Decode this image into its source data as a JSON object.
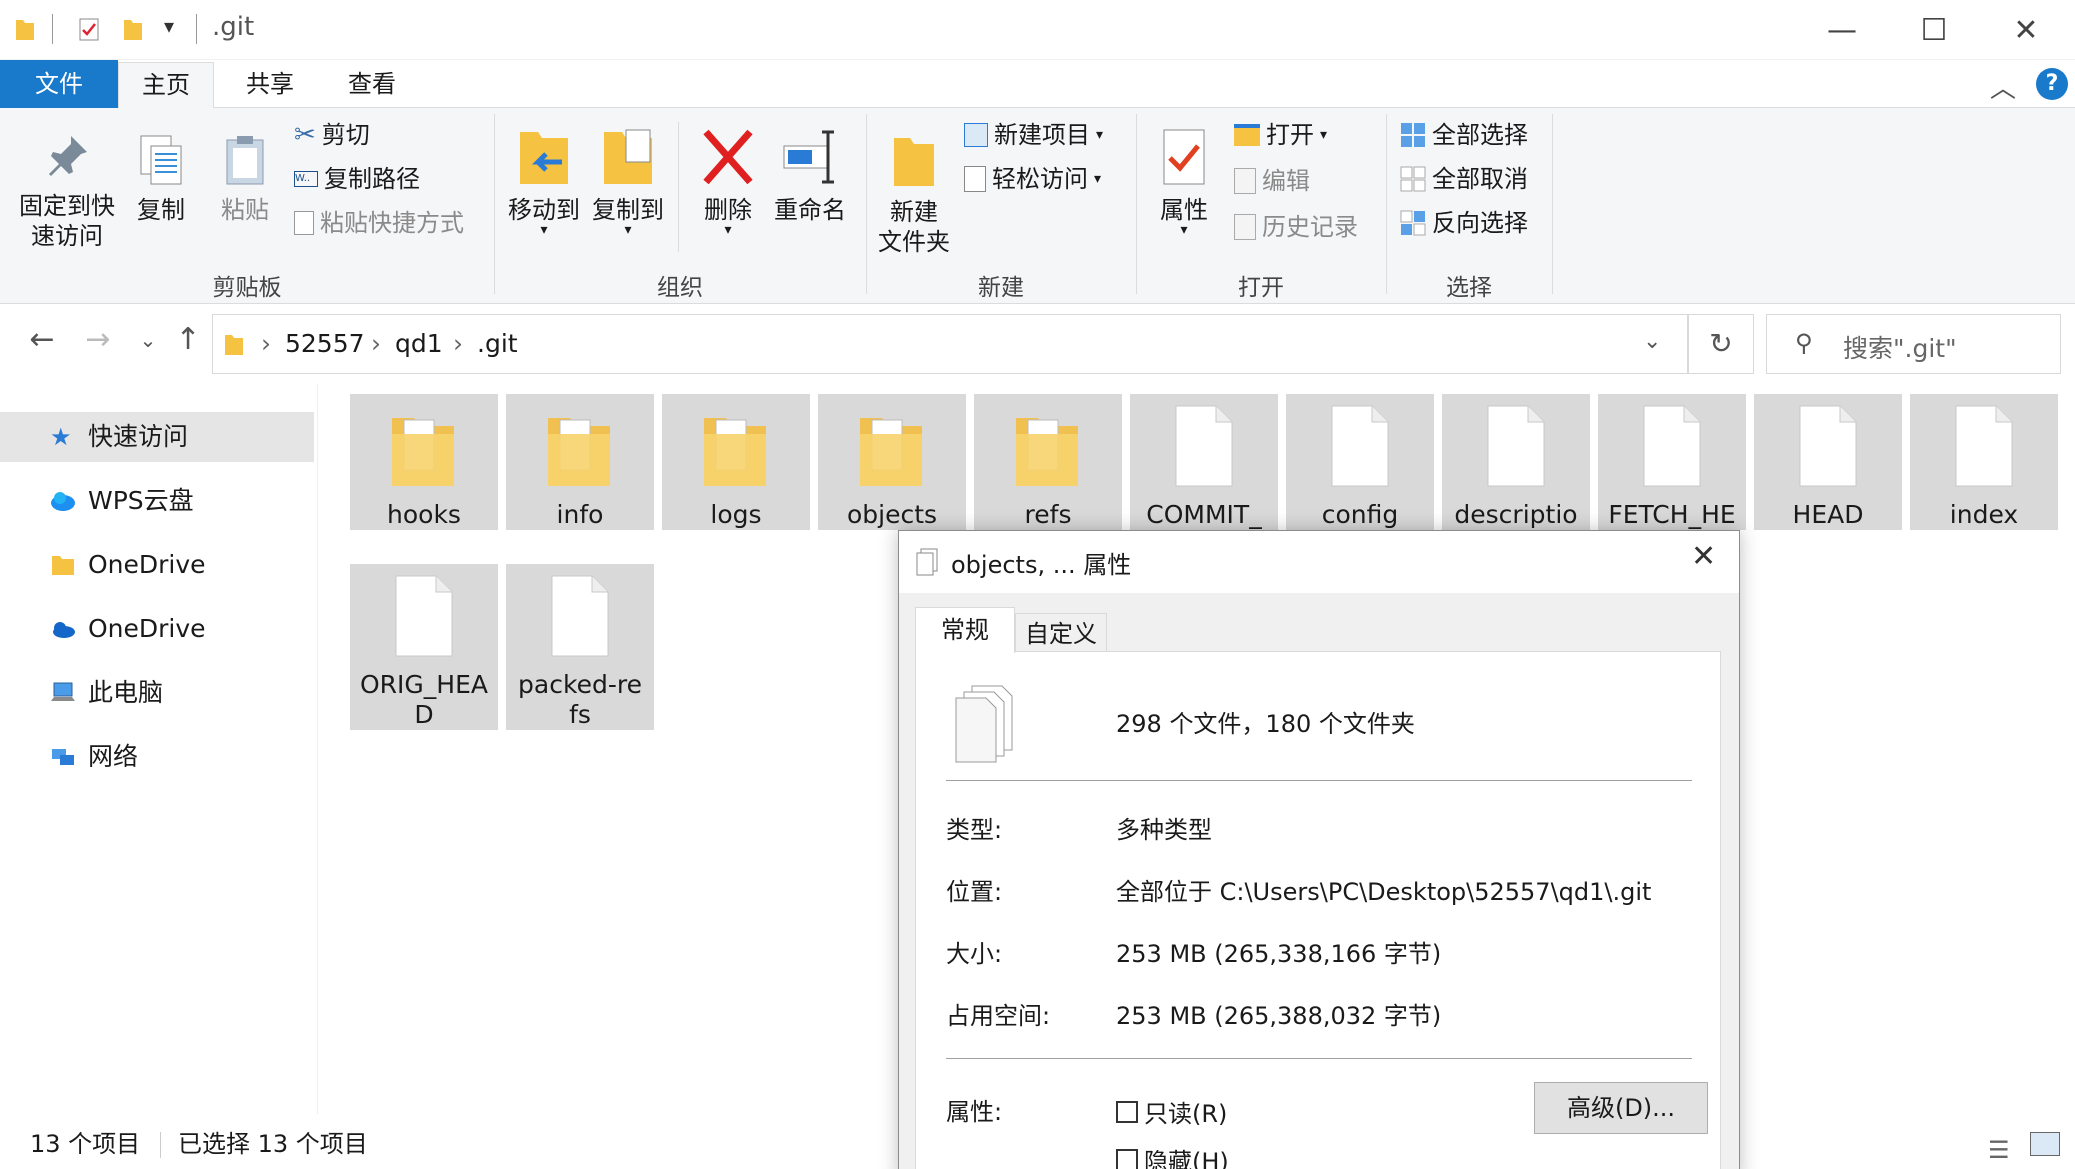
{
  "window": {
    "title": ".git",
    "controls": {
      "minimize": "—",
      "maximize": "☐",
      "close": "✕"
    }
  },
  "ribbon_tabs": [
    "文件",
    "主页",
    "共享",
    "查看"
  ],
  "ribbon": {
    "clipboard": {
      "pin": "固定到快速访问",
      "pin_line1": "固定到快",
      "pin_line2": "速访问",
      "copy": "复制",
      "paste": "粘贴",
      "cut": "剪切",
      "copy_path": "复制路径",
      "paste_shortcut": "粘贴快捷方式",
      "group": "剪贴板"
    },
    "organize": {
      "move_to": "移动到",
      "copy_to": "复制到",
      "delete": "删除",
      "rename": "重命名",
      "group": "组织"
    },
    "new": {
      "new_folder_line1": "新建",
      "new_folder_line2": "文件夹",
      "new_item": "新建项目",
      "easy_access": "轻松访问",
      "group": "新建"
    },
    "open": {
      "properties": "属性",
      "open": "打开",
      "edit": "编辑",
      "history": "历史记录",
      "group": "打开"
    },
    "select": {
      "select_all": "全部选择",
      "select_none": "全部取消",
      "invert": "反向选择",
      "group": "选择"
    }
  },
  "address": {
    "crumbs": [
      "52557",
      "qd1",
      ".git"
    ],
    "search_placeholder": "搜索\".git\""
  },
  "navpane": [
    {
      "label": "快速访问",
      "icon": "star-icon"
    },
    {
      "label": "WPS云盘",
      "icon": "cloud-icon"
    },
    {
      "label": "OneDrive",
      "icon": "folder-icon"
    },
    {
      "label": "OneDrive",
      "icon": "cloud-icon"
    },
    {
      "label": "此电脑",
      "icon": "computer-icon"
    },
    {
      "label": "网络",
      "icon": "network-icon"
    }
  ],
  "files": [
    {
      "name": "hooks",
      "type": "folder"
    },
    {
      "name": "info",
      "type": "folder"
    },
    {
      "name": "logs",
      "type": "folder"
    },
    {
      "name": "objects",
      "type": "folder"
    },
    {
      "name": "refs",
      "type": "folder"
    },
    {
      "name": "COMMIT_",
      "type": "file"
    },
    {
      "name": "config",
      "type": "file"
    },
    {
      "name": "descriptio",
      "type": "file"
    },
    {
      "name": "FETCH_HE",
      "type": "file"
    },
    {
      "name": "HEAD",
      "type": "file"
    },
    {
      "name": "index",
      "type": "file"
    },
    {
      "name": "ORIG_HEA D",
      "type": "file"
    },
    {
      "name": "packed-re fs",
      "type": "file"
    }
  ],
  "status": {
    "count": "13 个项目",
    "selected": "已选择 13 个项目"
  },
  "dialog": {
    "title": "objects, ... 属性",
    "tabs": [
      "常规",
      "自定义"
    ],
    "summary": "298 个文件，180 个文件夹",
    "type_label": "类型:",
    "type_value": "多种类型",
    "location_label": "位置:",
    "location_value": "全部位于 C:\\Users\\PC\\Desktop\\52557\\qd1\\.git",
    "size_label": "大小:",
    "size_value": "253 MB (265,338,166 字节)",
    "disk_label": "占用空间:",
    "disk_value": "253 MB (265,388,032 字节)",
    "attr_label": "属性:",
    "readonly": "只读(R)",
    "hidden": "隐藏(H)",
    "advanced": "高级(D)..."
  }
}
